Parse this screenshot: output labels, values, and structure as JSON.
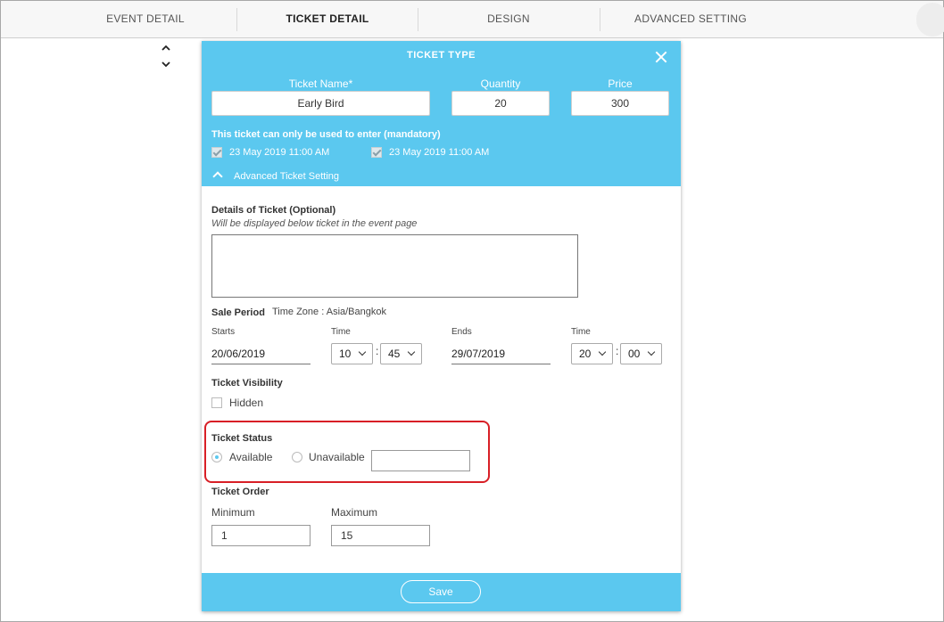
{
  "nav": {
    "tabs": [
      {
        "label": "EVENT DETAIL"
      },
      {
        "label": "TICKET DETAIL"
      },
      {
        "label": "DESIGN"
      },
      {
        "label": "ADVANCED SETTING"
      }
    ],
    "active_tab": "TICKET DETAIL"
  },
  "reorder": {
    "up_icon": "chevron-up-icon",
    "down_icon": "chevron-down-icon"
  },
  "modal": {
    "title": "TICKET TYPE",
    "close_icon": "close-icon",
    "ticket_name_label": "Ticket Name*",
    "ticket_name_value": "Early Bird",
    "quantity_label": "Quantity",
    "quantity_value": "20",
    "price_label": "Price",
    "price_value": "300",
    "mandatory_text": "This ticket can only be used to enter (mandatory)",
    "entry_options": [
      {
        "label": "23 May 2019 11:00 AM",
        "checked": true
      },
      {
        "label": "23 May 2019 11:00 AM",
        "checked": true
      }
    ],
    "advanced_toggle": "Advanced Ticket Setting",
    "details": {
      "title": "Details of Ticket (Optional)",
      "hint": "Will be displayed below ticket in the event page",
      "value": ""
    },
    "sale_period": {
      "title": "Sale Period",
      "timezone": "Time Zone : Asia/Bangkok",
      "starts_label": "Starts",
      "starts_value": "20/06/2019",
      "start_time_label": "Time",
      "start_hour": "10",
      "start_minute": "45",
      "ends_label": "Ends",
      "ends_value": "29/07/2019",
      "end_time_label": "Time",
      "end_hour": "20",
      "end_minute": "00",
      "colon": ":"
    },
    "visibility": {
      "title": "Ticket Visibility",
      "hidden_label": "Hidden",
      "hidden_checked": false
    },
    "status": {
      "title": "Ticket Status",
      "available_label": "Available",
      "unavailable_label": "Unavailable",
      "selected": "Available",
      "note_value": ""
    },
    "order": {
      "title": "Ticket Order",
      "minimum_label": "Minimum",
      "minimum_value": "1",
      "maximum_label": "Maximum",
      "maximum_value": "15"
    },
    "save_label": "Save"
  },
  "colors": {
    "accent": "#5bc8ef",
    "highlight": "#d81f26"
  }
}
